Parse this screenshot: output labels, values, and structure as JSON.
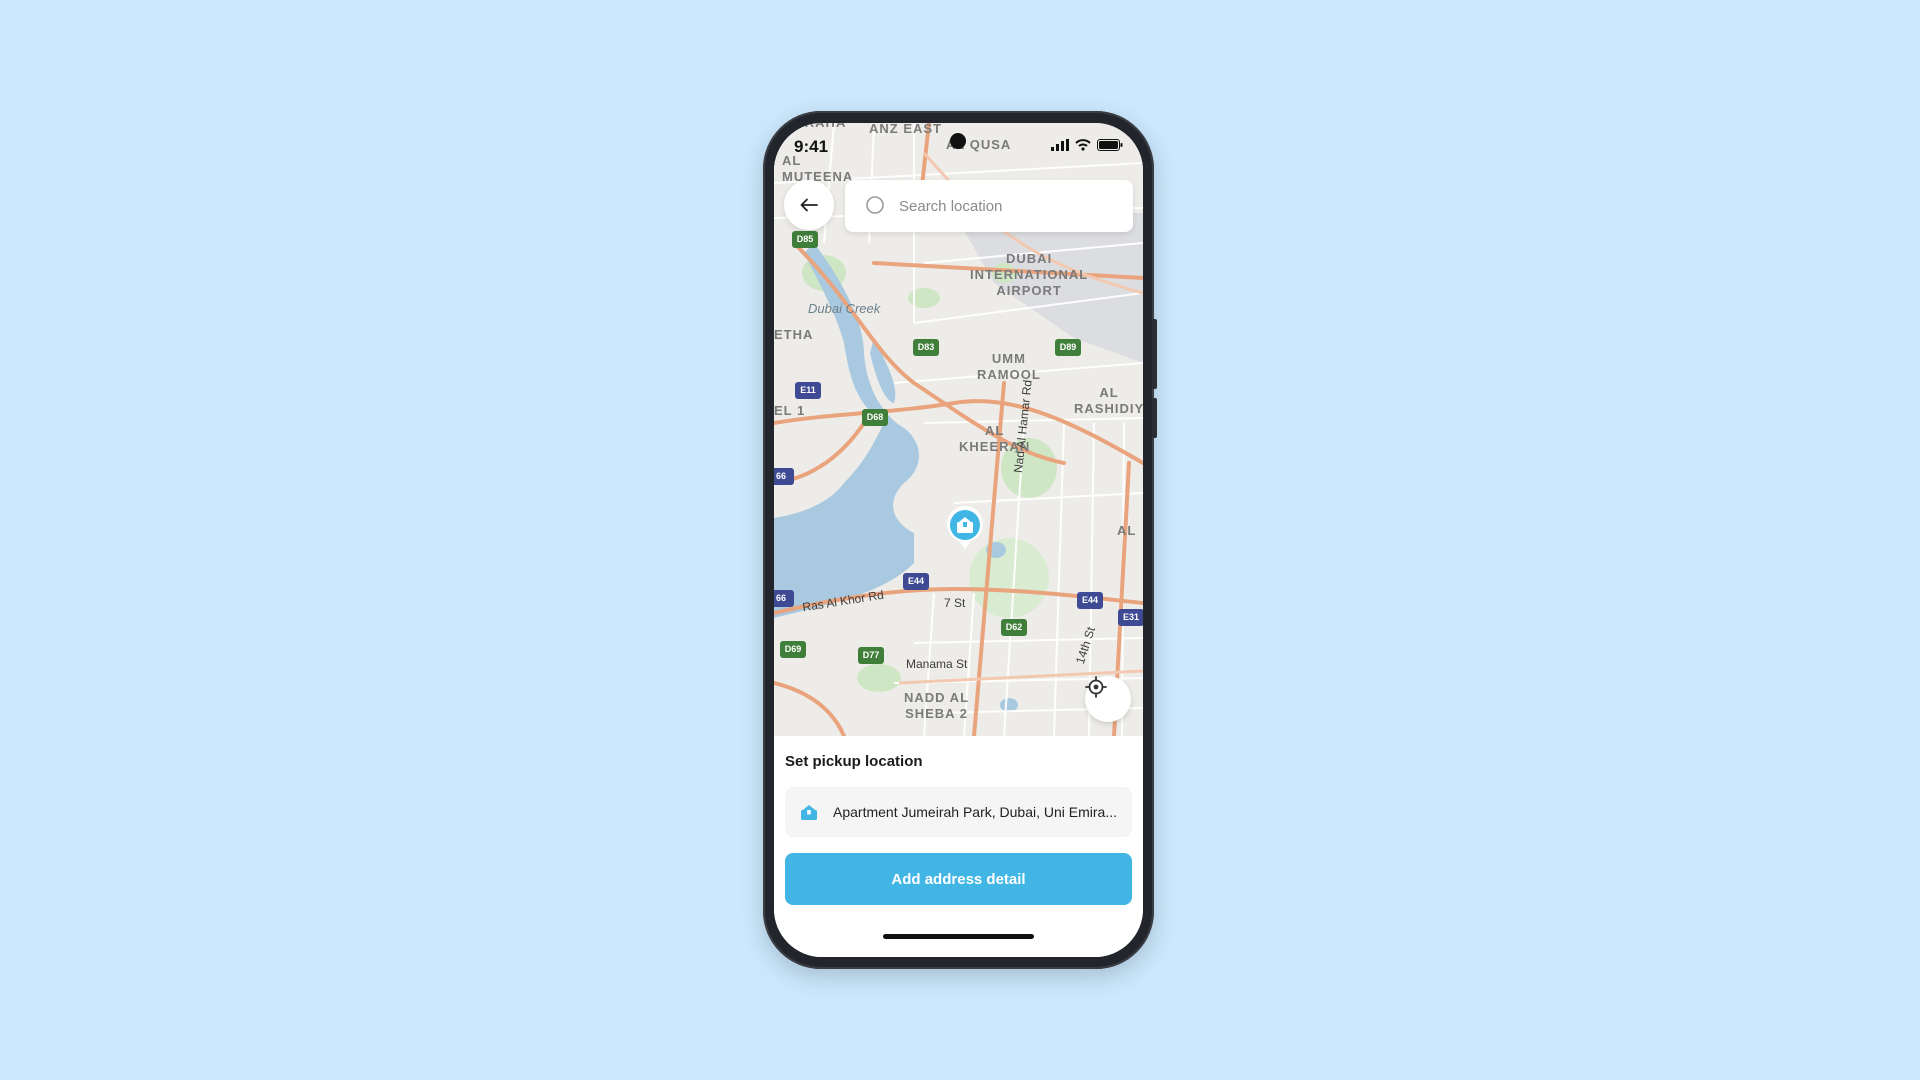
{
  "status_bar": {
    "time": "9:41"
  },
  "search": {
    "placeholder": "Search location"
  },
  "map": {
    "area_labels": {
      "baraha": "BARAHA",
      "anz_east": "ANZ EAST",
      "al_qusais": "AL QUSA",
      "muteena": "AL\nMUTEENA",
      "dubai_airport": "DUBAI\nINTERNATIONAL\nAIRPORT",
      "dubai_creek": "Dubai Creek",
      "etha": "ETHA",
      "umm_ramool": "UMM\nRAMOOL",
      "al_rashidiya": "AL\nRASHIDIY",
      "el1": "EL 1",
      "al_kheeran": "AL\nKHEERAN",
      "al": "AL",
      "nadd_al_sheba": "NADD AL\nSHEBA 2"
    },
    "road_labels": {
      "ras_al_khor": "Ras Al Khor Rd",
      "nad_al_hamar": "Nad Al Hamar Rd",
      "st7": "7 St",
      "st14": "14th St",
      "manama": "Manama St"
    },
    "shields": {
      "d85": "D85",
      "d83": "D83",
      "d89": "D89",
      "d68": "D68",
      "e11": "E11",
      "e66a": "66",
      "e66b": "66",
      "e44a": "E44",
      "e44b": "E44",
      "e31": "E31",
      "d62": "D62",
      "d69": "D69",
      "d77": "D77"
    }
  },
  "sheet": {
    "title": "Set pickup location",
    "address": "Apartment Jumeirah Park, Dubai, Uni Emira...",
    "cta": "Add address detail"
  },
  "colors": {
    "background": "#cce8fd",
    "accent": "#41b6e4",
    "water": "#a9c9e0",
    "road": "#e9a47d",
    "park": "#cfe6c4"
  },
  "icons": {
    "back": "arrow-left-icon",
    "search": "search-icon",
    "locate": "crosshair-icon",
    "pin": "package-pin-icon",
    "address": "package-icon"
  }
}
